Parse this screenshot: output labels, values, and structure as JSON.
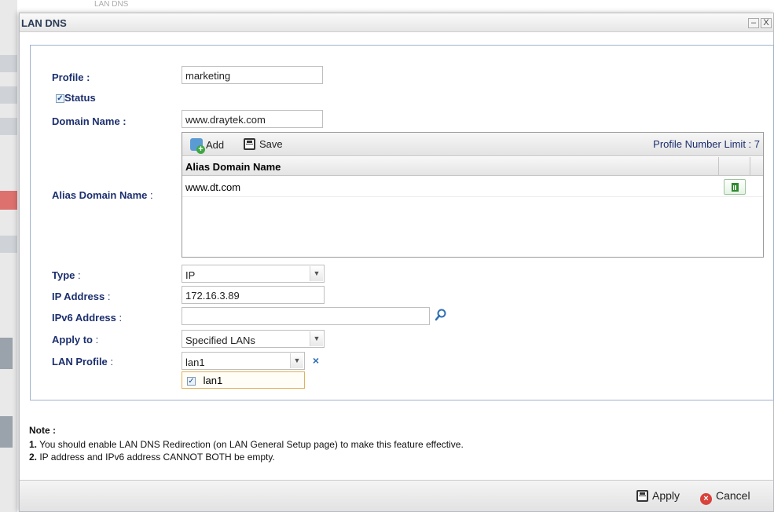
{
  "background": {
    "tab_label": "LAN DNS"
  },
  "dialog": {
    "title": "LAN DNS",
    "minimize_glyph": "–",
    "close_glyph": "X"
  },
  "form": {
    "profile_label": "Profile :",
    "profile_value": "marketing",
    "status_label": "Status",
    "status_checked": true,
    "domain_label": "Domain Name :",
    "domain_value": "www.draytek.com",
    "alias_label": "Alias Domain Name",
    "alias_colon": " :",
    "type_label": "Type",
    "type_colon": " :",
    "type_value": "IP",
    "ip_label": "IP Address",
    "ip_colon": " :",
    "ip_value": "172.16.3.89",
    "ipv6_label": "IPv6 Address",
    "ipv6_colon": " :",
    "ipv6_value": "",
    "apply_label": "Apply to",
    "apply_colon": " :",
    "apply_value": "Specified LANs",
    "lan_label": "LAN Profile",
    "lan_colon": " :",
    "lan_value": "lan1",
    "lan_option": "lan1"
  },
  "alias_grid": {
    "add_label": "Add",
    "save_label": "Save",
    "limit_label": "Profile Number Limit : 7",
    "column_header": "Alias Domain Name",
    "rows": [
      "www.dt.com"
    ]
  },
  "notes": {
    "title": "Note :",
    "n1_num": "1.",
    "n1_text": " You should enable LAN DNS Redirection (on LAN General Setup page) to make this feature effective.",
    "n2_num": "2.",
    "n2_text": " IP address and IPv6 address CANNOT BOTH be empty."
  },
  "footer": {
    "apply_label": "Apply",
    "cancel_label": "Cancel"
  },
  "icons": [
    "add-icon",
    "save-icon",
    "trash-icon",
    "search-icon",
    "clear-icon",
    "cancel-icon",
    "chevron-down-icon"
  ]
}
